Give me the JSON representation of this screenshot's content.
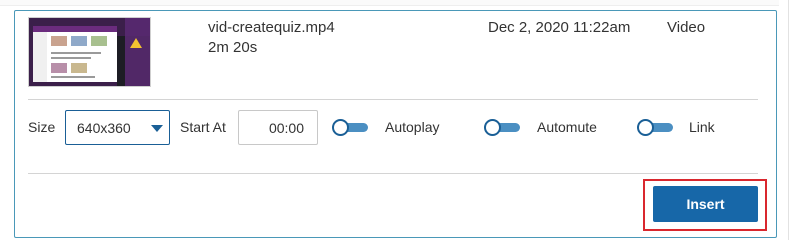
{
  "file": {
    "name": "vid-createquiz.mp4",
    "duration": "2m 20s",
    "date": "Dec 2, 2020 11:22am",
    "type": "Video"
  },
  "options": {
    "size_label": "Size",
    "size_value": "640x360",
    "start_label": "Start At",
    "start_value": "00:00",
    "autoplay_label": "Autoplay",
    "automute_label": "Automute",
    "link_label": "Link"
  },
  "actions": {
    "insert_label": "Insert"
  },
  "colors": {
    "accent": "#1767a8",
    "highlight": "#d9272e",
    "panel_border": "#4a98b8"
  }
}
